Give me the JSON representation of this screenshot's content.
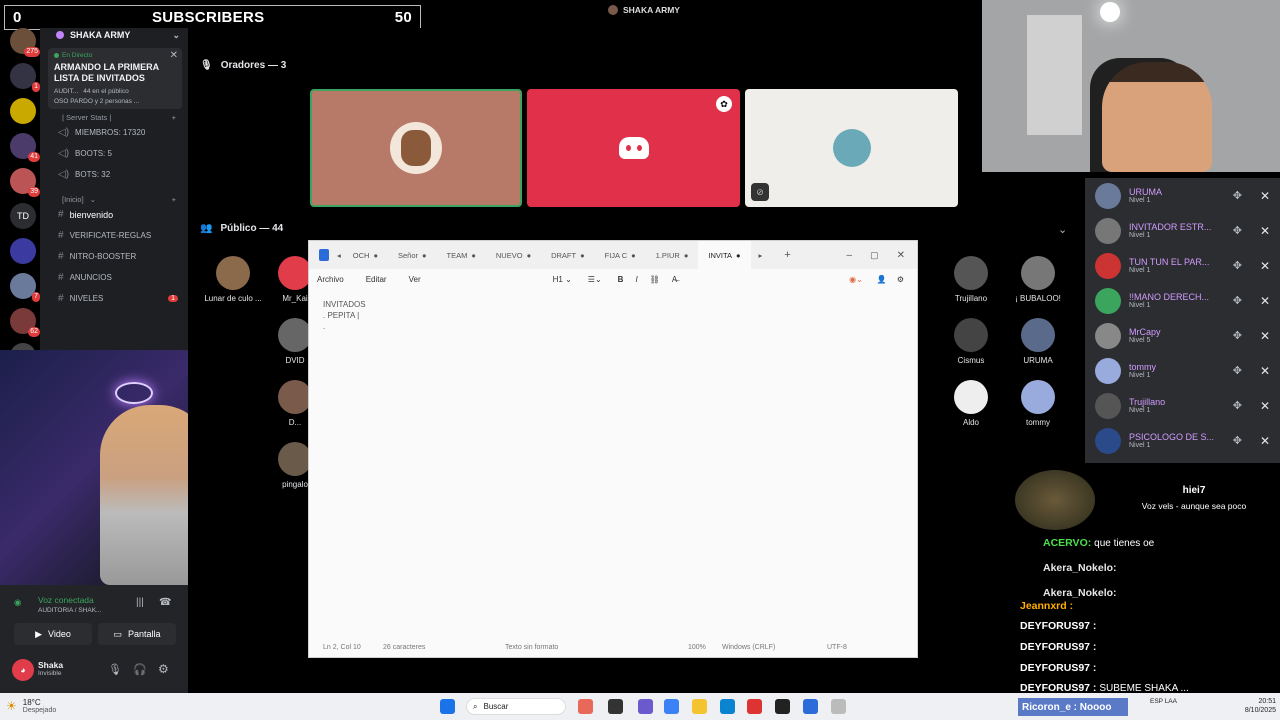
{
  "overlay": {
    "sub_count": "0",
    "sub_label": "SUBSCRIBERS",
    "sub_goal": "50"
  },
  "discord": {
    "server_name": "SHAKA ARMY",
    "stage_title": "SHAKA ARMY",
    "live_label": "En Directo",
    "live_title": "ARMANDO LA PRIMERA LISTA DE INVITADOS",
    "live_meta1": "AUDIT...",
    "live_meta2": "44 en el público",
    "live_meta3": "OSO PARDO y 2 personas ...",
    "stats_header": "| Server Stats |",
    "stats": [
      "MIEMBROS: 17320",
      "BOOTS: 5",
      "BOTS: 32"
    ],
    "category": "[Inicio]",
    "channels": [
      "bienvenido",
      "VERIFICATE-REGLAS",
      "NITRO-BOOSTER",
      "ANUNCIOS",
      "NIVELES"
    ],
    "niveles_badge": "1",
    "server_rail": [
      {
        "label": "",
        "badge": "275",
        "color": "#6b4f3a"
      },
      {
        "label": "",
        "badge": "1",
        "color": "#334"
      },
      {
        "label": "",
        "badge": "",
        "color": "#c9a800"
      },
      {
        "label": "",
        "badge": "41",
        "color": "#4b3b6b"
      },
      {
        "label": "",
        "badge": "39",
        "color": "#b55"
      },
      {
        "label": "TD",
        "badge": "",
        "color": "#2b2d31"
      },
      {
        "label": "",
        "badge": "",
        "color": "#3a3aa0"
      },
      {
        "label": "",
        "badge": "7",
        "color": "#6a7a9a"
      },
      {
        "label": "",
        "badge": "62",
        "color": "#7a3a3a"
      },
      {
        "label": "",
        "badge": "1",
        "color": "#444"
      }
    ],
    "speakers_header": "Oradores — 3",
    "public_header": "Público — 44",
    "audience": [
      {
        "name": "Lunar de culo ...",
        "color": "#8a6a4a"
      },
      {
        "name": "Mr_Kai",
        "color": "#e03c4a"
      },
      {
        "name": "Trujillano",
        "color": "#555"
      },
      {
        "name": "¡ BUBALOO!",
        "color": "#777"
      },
      {
        "name": "DVID",
        "color": "#666"
      },
      {
        "name": "Cismus",
        "color": "#444"
      },
      {
        "name": "URUMA",
        "color": "#5a6a8a"
      },
      {
        "name": "D...",
        "color": "#7a5a4a"
      },
      {
        "name": "Aldo",
        "color": "#eee"
      },
      {
        "name": "tommy",
        "color": "#9ad"
      },
      {
        "name": "pingalo",
        "color": "#6a5a4a"
      }
    ],
    "voice_status": "Voz conectada",
    "voice_channel": "AUDITORIA / SHAK...",
    "video_label": "Video",
    "screen_label": "Pantalla",
    "user_name": "Shaka",
    "user_status": "Invisible"
  },
  "notepad": {
    "tabs": [
      "OCH",
      "Señor",
      "TEAM",
      "NUEVO",
      "DRAFT",
      "FIJA C",
      "1.PIUR",
      "INVITA"
    ],
    "menus": [
      "Archivo",
      "Editar",
      "Ver"
    ],
    "heading_label": "H1",
    "lines": [
      "INVITADOS",
      ". PEPITA |",
      "."
    ],
    "status": {
      "position": "Ln 2, Col 10",
      "chars": "26 caracteres",
      "format": "Texto sin formato",
      "zoom": "100%",
      "eol": "Windows (CRLF)",
      "encoding": "UTF-8"
    }
  },
  "members": [
    {
      "name": "URUMA",
      "level": "Nivel 1",
      "color": "#6a7a9a"
    },
    {
      "name": "INVITADOR ESTR...",
      "level": "Nivel 1",
      "color": "#777"
    },
    {
      "name": "TUN TUN EL PAR...",
      "level": "Nivel 1",
      "color": "#c33"
    },
    {
      "name": "!!MANO DERECH...",
      "level": "Nivel 1",
      "color": "#3ba55d"
    },
    {
      "name": "MrCapy",
      "level": "Nivel 5",
      "color": "#888"
    },
    {
      "name": "tommy",
      "level": "Nivel 1",
      "color": "#9ad"
    },
    {
      "name": "Trujillano",
      "level": "Nivel 1",
      "color": "#555"
    },
    {
      "name": "PSICOLOGO DE S...",
      "level": "Nivel 1",
      "color": "#2a4a8a"
    }
  ],
  "chat": {
    "featured_user": "hiei7",
    "featured_msg": "Voz vels - aunque sea poco",
    "lines": [
      {
        "user": "ACERVO:",
        "msg": "que tienes oe",
        "color": "#4be04b"
      },
      {
        "user": "Akera_Nokelo:",
        "msg": "",
        "color": "#e8e8e8"
      },
      {
        "user": "Akera_Nokelo:",
        "msg": "",
        "color": "#e8e8e8"
      },
      {
        "user": "Jeannxrd :",
        "msg": "",
        "color": "#ffb000"
      },
      {
        "user": "DEYFORUS97 :",
        "msg": "",
        "color": "#ffffff"
      },
      {
        "user": "DEYFORUS97 :",
        "msg": "",
        "color": "#ffffff"
      },
      {
        "user": "DEYFORUS97 :",
        "msg": "",
        "color": "#ffffff"
      },
      {
        "user": "DEYFORUS97 :",
        "msg": "SUBEME SHAKA ...",
        "color": "#ffffff"
      }
    ],
    "bottom_line": "Ricoron_e : Noooo"
  },
  "taskbar": {
    "temp": "18°C",
    "weather": "Despejado",
    "search": "Buscar",
    "lang": "ESP LAA",
    "time": "20:51",
    "date": "8/10/2025"
  },
  "colors": {
    "discord_blurple": "#5865f2",
    "discord_red": "#e0304a",
    "speaker_brown": "#b87a68"
  }
}
